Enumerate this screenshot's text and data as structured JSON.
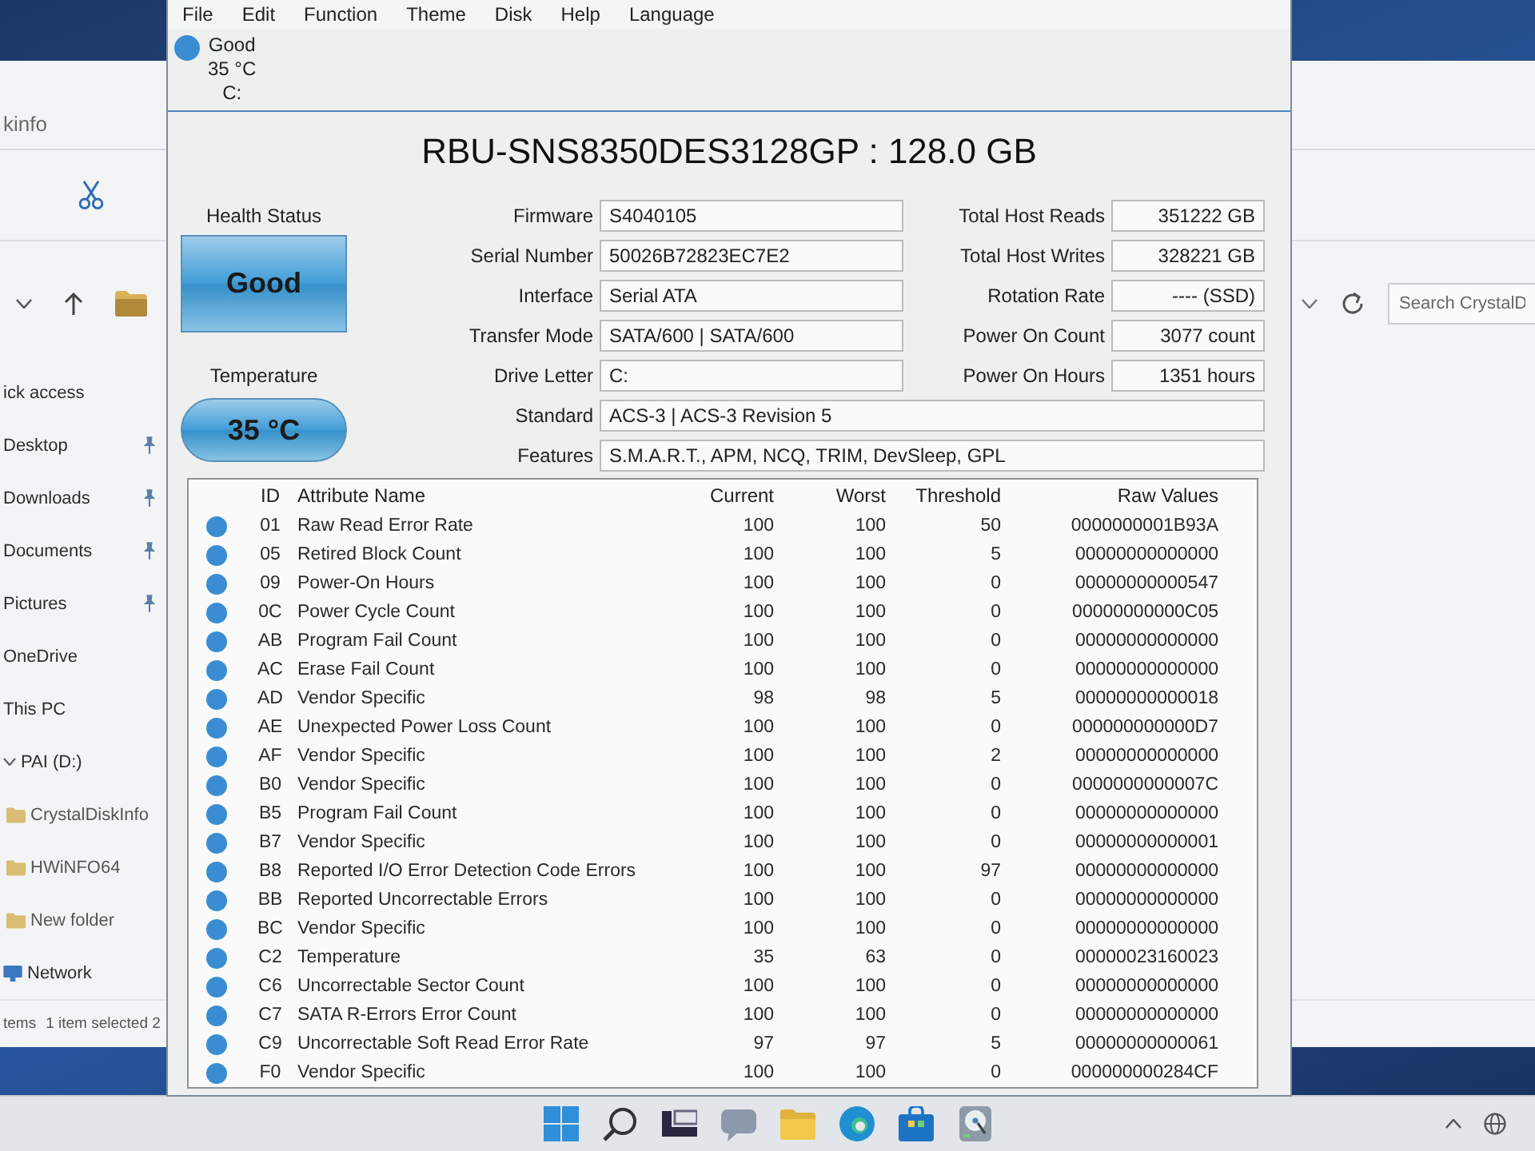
{
  "explorer": {
    "title": "kinfo",
    "search": {
      "placeholder": "Search CrystalD"
    },
    "nav_items": [
      {
        "label": "ick access",
        "kind": "plain",
        "pinned": false,
        "expanded": false
      },
      {
        "label": "Desktop",
        "kind": "plain",
        "pinned": true,
        "expanded": false
      },
      {
        "label": "Downloads",
        "kind": "plain",
        "pinned": true,
        "expanded": false
      },
      {
        "label": "Documents",
        "kind": "plain",
        "pinned": true,
        "expanded": false
      },
      {
        "label": "Pictures",
        "kind": "plain",
        "pinned": true,
        "expanded": false
      },
      {
        "label": "OneDrive",
        "kind": "plain",
        "pinned": false,
        "expanded": false
      },
      {
        "label": "This PC",
        "kind": "plain",
        "pinned": false,
        "expanded": false
      },
      {
        "label": "PAI (D:)",
        "kind": "plain",
        "pinned": false,
        "expanded": true,
        "children": [
          {
            "label": "CrystalDiskInfo",
            "kind": "folder",
            "pinned": false,
            "expanded": false
          },
          {
            "label": "HWiNFO64",
            "kind": "folder",
            "pinned": false,
            "expanded": false
          },
          {
            "label": "New folder",
            "kind": "folder",
            "pinned": false,
            "expanded": false
          }
        ]
      },
      {
        "label": "Network",
        "kind": "network",
        "pinned": false,
        "expanded": false
      }
    ],
    "status_bar": {
      "items": "tems",
      "selection": "1 item selected 2"
    }
  },
  "crystaldiskinfo": {
    "menu": [
      "File",
      "Edit",
      "Function",
      "Theme",
      "Disk",
      "Help",
      "Language"
    ],
    "drives": [
      {
        "color": "#3a8dd2",
        "health": "Good",
        "temperature": "35 °C",
        "letter": "C:"
      }
    ],
    "model": "RBU-SNS8350DES3128GP : 128.0 GB",
    "health": {
      "label": "Health Status",
      "value": "Good",
      "color": "#3a9ad6"
    },
    "temperature": {
      "label": "Temperature",
      "value": "35 °C",
      "color": "#3a9ad6"
    },
    "details": [
      {
        "label": "Firmware",
        "value": "S4040105"
      },
      {
        "label": "Serial Number",
        "value": "50026B72823EC7E2"
      },
      {
        "label": "Interface",
        "value": "Serial ATA"
      },
      {
        "label": "Transfer Mode",
        "value": "SATA/600 | SATA/600"
      },
      {
        "label": "Drive Letter",
        "value": "C:"
      }
    ],
    "counters": [
      {
        "label": "Total Host Reads",
        "value": "351222 GB"
      },
      {
        "label": "Total Host Writes",
        "value": "328221 GB"
      },
      {
        "label": "Rotation Rate",
        "value": "---- (SSD)"
      },
      {
        "label": "Power On Count",
        "value": "3077 count"
      },
      {
        "label": "Power On Hours",
        "value": "1351 hours"
      }
    ],
    "wide_details": [
      {
        "label": "Standard",
        "value": "ACS-3 | ACS-3 Revision 5"
      },
      {
        "label": "Features",
        "value": "S.M.A.R.T., APM, NCQ, TRIM, DevSleep, GPL"
      }
    ],
    "smart": {
      "columns": [
        "ID",
        "Attribute Name",
        "Current",
        "Worst",
        "Threshold",
        "Raw Values"
      ],
      "rows": [
        {
          "color": "#3a8dd2",
          "id": "01",
          "name": "Raw Read Error Rate",
          "current": "100",
          "worst": "100",
          "threshold": "50",
          "raw": "0000000001B93A"
        },
        {
          "color": "#3a8dd2",
          "id": "05",
          "name": "Retired Block Count",
          "current": "100",
          "worst": "100",
          "threshold": "5",
          "raw": "00000000000000"
        },
        {
          "color": "#3a8dd2",
          "id": "09",
          "name": "Power-On Hours",
          "current": "100",
          "worst": "100",
          "threshold": "0",
          "raw": "00000000000547"
        },
        {
          "color": "#3a8dd2",
          "id": "0C",
          "name": "Power Cycle Count",
          "current": "100",
          "worst": "100",
          "threshold": "0",
          "raw": "00000000000C05"
        },
        {
          "color": "#3a8dd2",
          "id": "AB",
          "name": "Program Fail Count",
          "current": "100",
          "worst": "100",
          "threshold": "0",
          "raw": "00000000000000"
        },
        {
          "color": "#3a8dd2",
          "id": "AC",
          "name": "Erase Fail Count",
          "current": "100",
          "worst": "100",
          "threshold": "0",
          "raw": "00000000000000"
        },
        {
          "color": "#3a8dd2",
          "id": "AD",
          "name": "Vendor Specific",
          "current": "98",
          "worst": "98",
          "threshold": "5",
          "raw": "00000000000018"
        },
        {
          "color": "#3a8dd2",
          "id": "AE",
          "name": "Unexpected Power Loss Count",
          "current": "100",
          "worst": "100",
          "threshold": "0",
          "raw": "000000000000D7"
        },
        {
          "color": "#3a8dd2",
          "id": "AF",
          "name": "Vendor Specific",
          "current": "100",
          "worst": "100",
          "threshold": "2",
          "raw": "00000000000000"
        },
        {
          "color": "#3a8dd2",
          "id": "B0",
          "name": "Vendor Specific",
          "current": "100",
          "worst": "100",
          "threshold": "0",
          "raw": "0000000000007C"
        },
        {
          "color": "#3a8dd2",
          "id": "B5",
          "name": "Program Fail Count",
          "current": "100",
          "worst": "100",
          "threshold": "0",
          "raw": "00000000000000"
        },
        {
          "color": "#3a8dd2",
          "id": "B7",
          "name": "Vendor Specific",
          "current": "100",
          "worst": "100",
          "threshold": "0",
          "raw": "00000000000001"
        },
        {
          "color": "#3a8dd2",
          "id": "B8",
          "name": "Reported I/O Error Detection Code Errors",
          "current": "100",
          "worst": "100",
          "threshold": "97",
          "raw": "00000000000000"
        },
        {
          "color": "#3a8dd2",
          "id": "BB",
          "name": "Reported Uncorrectable Errors",
          "current": "100",
          "worst": "100",
          "threshold": "0",
          "raw": "00000000000000"
        },
        {
          "color": "#3a8dd2",
          "id": "BC",
          "name": "Vendor Specific",
          "current": "100",
          "worst": "100",
          "threshold": "0",
          "raw": "00000000000000"
        },
        {
          "color": "#3a8dd2",
          "id": "C2",
          "name": "Temperature",
          "current": "35",
          "worst": "63",
          "threshold": "0",
          "raw": "00000023160023"
        },
        {
          "color": "#3a8dd2",
          "id": "C6",
          "name": "Uncorrectable Sector Count",
          "current": "100",
          "worst": "100",
          "threshold": "0",
          "raw": "00000000000000"
        },
        {
          "color": "#3a8dd2",
          "id": "C7",
          "name": "SATA R-Errors Error Count",
          "current": "100",
          "worst": "100",
          "threshold": "0",
          "raw": "00000000000000"
        },
        {
          "color": "#3a8dd2",
          "id": "C9",
          "name": "Uncorrectable Soft Read Error Rate",
          "current": "97",
          "worst": "97",
          "threshold": "5",
          "raw": "00000000000061"
        },
        {
          "color": "#3a8dd2",
          "id": "F0",
          "name": "Vendor Specific",
          "current": "100",
          "worst": "100",
          "threshold": "0",
          "raw": "000000000284CF"
        }
      ]
    }
  }
}
